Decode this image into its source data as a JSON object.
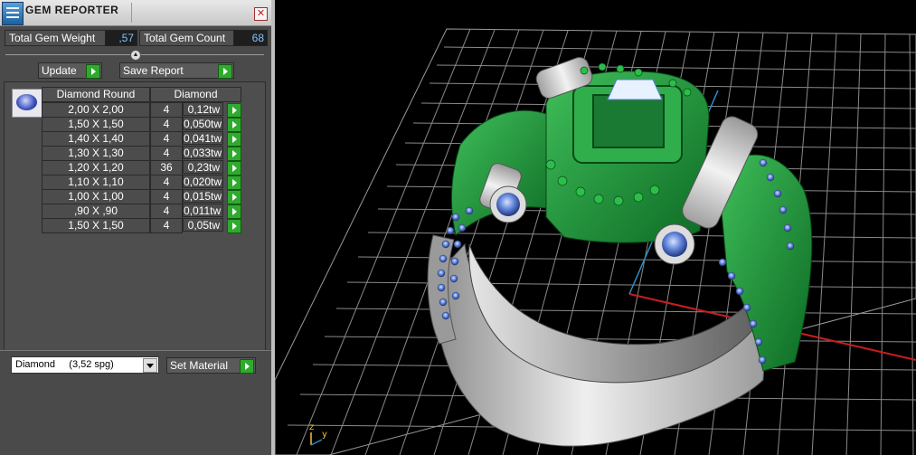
{
  "window": {
    "title": "GEM REPORTER",
    "close_glyph": "✕"
  },
  "summary": {
    "weight_label": "Total Gem Weight",
    "weight_value": ",57",
    "count_label": "Total Gem Count",
    "count_value": "68"
  },
  "actions": {
    "update_label": "Update",
    "save_label": "Save Report"
  },
  "table": {
    "headers": [
      "Diamond Round",
      "Diamond"
    ],
    "rows": [
      {
        "size": "2,00 X 2,00",
        "count": "4",
        "weight": "0,12tw"
      },
      {
        "size": "1,50 X 1,50",
        "count": "4",
        "weight": "0,050tw"
      },
      {
        "size": "1,40 X 1,40",
        "count": "4",
        "weight": "0,041tw"
      },
      {
        "size": "1,30 X 1,30",
        "count": "4",
        "weight": "0,033tw"
      },
      {
        "size": "1,20 X 1,20",
        "count": "36",
        "weight": "0,23tw"
      },
      {
        "size": "1,10 X 1,10",
        "count": "4",
        "weight": "0,020tw"
      },
      {
        "size": "1,00 X 1,00",
        "count": "4",
        "weight": "0,015tw"
      },
      {
        "size": ",90 X ,90",
        "count": "4",
        "weight": "0,011tw"
      },
      {
        "size": "1,50 X 1,50",
        "count": "4",
        "weight": "0,05tw"
      }
    ]
  },
  "material": {
    "selected": "Diamond     (3,52 spg)",
    "set_label": "Set Material"
  },
  "viewport": {
    "axis_y": "y",
    "axis_z": "z"
  },
  "colors": {
    "panel": "#4a4a4a",
    "accent_green": "#2faa2f",
    "value_text": "#7fc4ff",
    "grid": "#8a8a8a",
    "model_green": "#1f9a3a",
    "model_metal": "#c9c9c9",
    "stone_blue": "#5b7fd6"
  }
}
